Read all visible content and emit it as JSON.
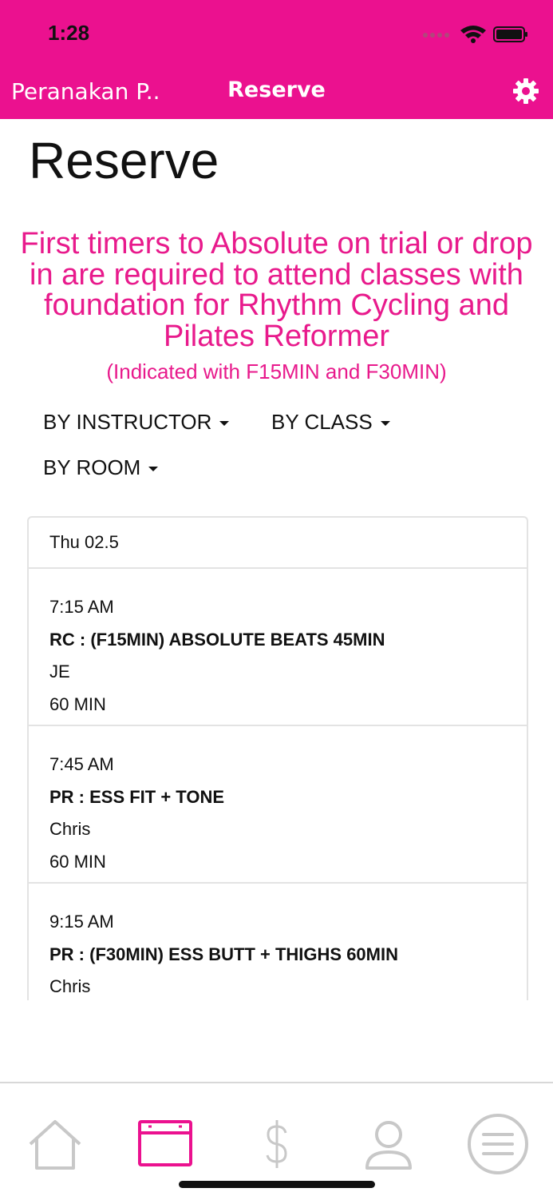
{
  "status_bar": {
    "time": "1:28"
  },
  "nav": {
    "back_label": "Peranakan P..",
    "title": "Reserve"
  },
  "page_title": "Reserve",
  "notice": {
    "main": "First timers to Absolute on trial or drop in are required to attend classes with foundation for Rhythm Cycling and Pilates Reformer",
    "sub": "(Indicated with F15MIN and F30MIN)"
  },
  "filters": {
    "instructor": "BY INSTRUCTOR",
    "class": "BY CLASS",
    "room": "BY ROOM"
  },
  "schedule": {
    "date": "Thu 02.5",
    "classes": [
      {
        "time": "7:15 AM",
        "name": "RC : (F15MIN) ABSOLUTE BEATS 45MIN",
        "instructor": "JE",
        "duration": "60 MIN"
      },
      {
        "time": "7:45 AM",
        "name": "PR : ESS FIT + TONE",
        "instructor": "Chris",
        "duration": "60 MIN"
      },
      {
        "time": "9:15 AM",
        "name": "PR : (F30MIN) ESS BUTT + THIGHS 60MIN",
        "instructor": "Chris",
        "duration": ""
      }
    ]
  },
  "tabbar": {
    "items": [
      {
        "icon": "home-icon",
        "active": false
      },
      {
        "icon": "calendar-icon",
        "active": true
      },
      {
        "icon": "dollar-icon",
        "active": false
      },
      {
        "icon": "profile-icon",
        "active": false
      },
      {
        "icon": "menu-icon",
        "active": false
      }
    ]
  },
  "colors": {
    "accent": "#eb118f",
    "inactive": "#c8c8c8",
    "text": "#111111"
  }
}
